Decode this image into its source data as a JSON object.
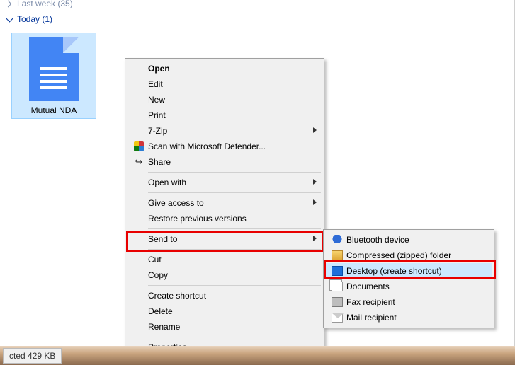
{
  "groups": {
    "last_week": {
      "label": "Last week",
      "count_suffix": "(35)"
    },
    "today": {
      "label": "Today",
      "count_suffix": "(1)"
    }
  },
  "file": {
    "name": "Mutual NDA"
  },
  "menu": {
    "open": "Open",
    "edit": "Edit",
    "new": "New",
    "print": "Print",
    "sevenzip": "7-Zip",
    "defender": "Scan with Microsoft Defender...",
    "share": "Share",
    "openwith": "Open with",
    "giveaccess": "Give access to",
    "restore": "Restore previous versions",
    "sendto": "Send to",
    "cut": "Cut",
    "copy": "Copy",
    "shortcut": "Create shortcut",
    "delete": "Delete",
    "rename": "Rename",
    "properties": "Properties"
  },
  "submenu": {
    "bluetooth": "Bluetooth device",
    "compressed": "Compressed (zipped) folder",
    "desktop": "Desktop (create shortcut)",
    "documents": "Documents",
    "fax": "Fax recipient",
    "mail": "Mail recipient"
  },
  "statusbar": {
    "text": "cted  429 KB"
  }
}
